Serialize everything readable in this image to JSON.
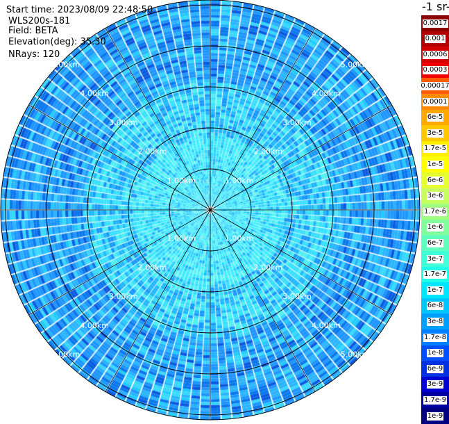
{
  "header": {
    "start_time": "Start time: 2023/08/09 22:48:50",
    "instrument": "WLS200s-181",
    "field": "Field: BETA",
    "elevation": "Elevation(deg): 35.30",
    "nrays": "NRays: 120"
  },
  "colorbar": {
    "title": "-1 sr-",
    "labels": [
      "0.0017",
      "0.001",
      "0.0006",
      "0.0003",
      "0.00017",
      "0.0001",
      "6e-5",
      "3e-5",
      "1.7e-5",
      "1e-5",
      "6e-6",
      "3e-6",
      "1.7e-6",
      "1e-6",
      "6e-7",
      "3e-7",
      "1.7e-7",
      "1e-7",
      "6e-8",
      "3e-8",
      "1.7e-8",
      "1e-8",
      "6e-9",
      "3e-9",
      "1.7e-9",
      "1e-9"
    ],
    "colors": [
      "#8b0000",
      "#b00000",
      "#d40000",
      "#f00000",
      "#ff5a00",
      "#ff8c00",
      "#ffa800",
      "#ffc800",
      "#ffee00",
      "#ffff00",
      "#e6ff30",
      "#c8ff60",
      "#a0ff80",
      "#80ff9c",
      "#60ffbe",
      "#40ffd8",
      "#20ffe8",
      "#00e6ff",
      "#00c4ff",
      "#00a0ff",
      "#0080ff",
      "#0050ff",
      "#0030e0",
      "#0000d0",
      "#0000a0",
      "#000080"
    ]
  },
  "range_labels": [
    "1.00km",
    "2.00km",
    "3.00km",
    "4.00km",
    "5.00km"
  ],
  "chart_data": {
    "type": "heatmap",
    "projection": "polar PPI",
    "field": "BETA",
    "nrays": 120,
    "range_rings_km": [
      1,
      2,
      3,
      4,
      5
    ],
    "max_range_km": 5.1,
    "value_range": [
      1e-09,
      0.0017
    ],
    "scale": "log"
  }
}
